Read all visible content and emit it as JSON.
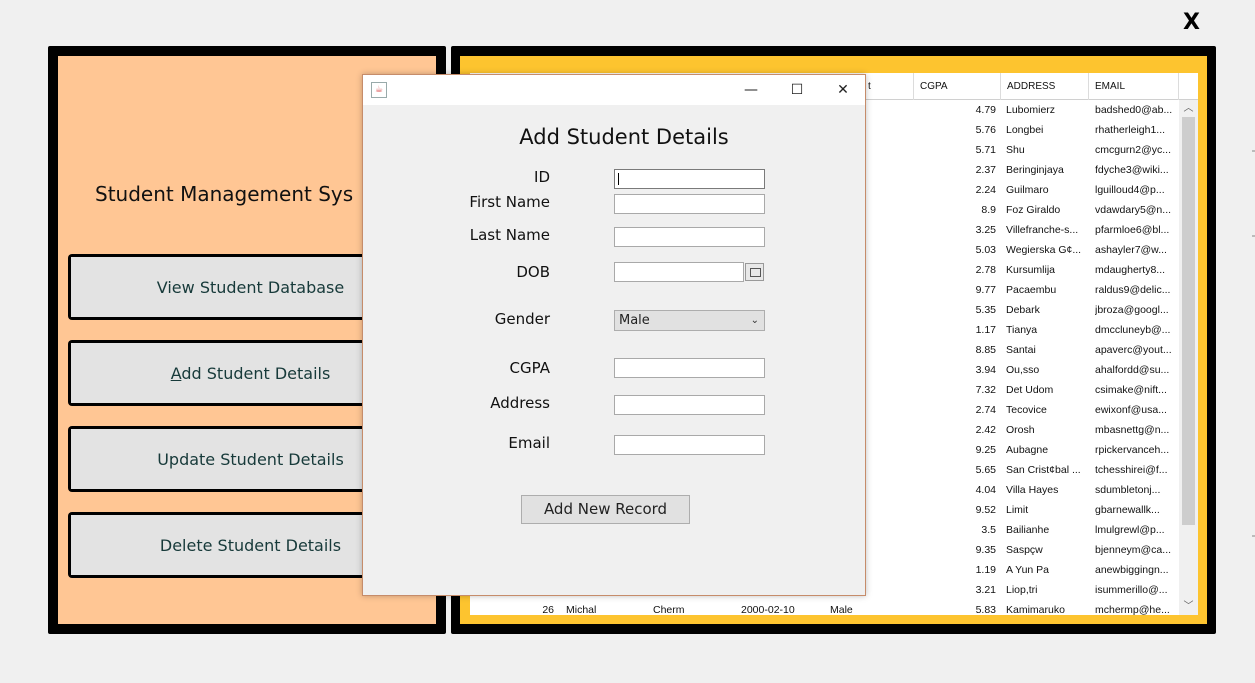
{
  "window": {
    "close_label": "X"
  },
  "sidebar": {
    "title": "Student Management Sys",
    "buttons": [
      {
        "label": "View Student Database"
      },
      {
        "label": "Add Student Details",
        "mnemonic": "A"
      },
      {
        "label": "Update Student Details"
      },
      {
        "label": "Delete Student Details"
      }
    ]
  },
  "table": {
    "headers": {
      "partial": "t",
      "cgpa": "CGPA",
      "address": "ADDRESS",
      "email": "EMAIL"
    },
    "rows": [
      {
        "cgpa": "4.79",
        "address": "Lubomierz",
        "email": "badshed0@ab..."
      },
      {
        "cgpa": "5.76",
        "address": "Longbei",
        "email": "rhatherleigh1..."
      },
      {
        "cgpa": "5.71",
        "address": "Shu",
        "email": "cmcgurn2@yc..."
      },
      {
        "cgpa": "2.37",
        "address": "Beringinjaya",
        "email": "fdyche3@wiki..."
      },
      {
        "cgpa": "2.24",
        "address": "Guilmaro",
        "email": "lguilloud4@p..."
      },
      {
        "cgpa": "8.9",
        "address": "Foz Giraldo",
        "email": "vdawdary5@n..."
      },
      {
        "cgpa": "3.25",
        "address": "Villefranche-s...",
        "email": "pfarmloe6@bl..."
      },
      {
        "cgpa": "5.03",
        "address": "Wegierska G¢...",
        "email": "ashayler7@w..."
      },
      {
        "cgpa": "2.78",
        "address": "Kursumlija",
        "email": "mdaugherty8..."
      },
      {
        "cgpa": "9.77",
        "address": "Pacaembu",
        "email": "raldus9@delic..."
      },
      {
        "cgpa": "5.35",
        "address": "Debark",
        "email": "jbroza@googl..."
      },
      {
        "cgpa": "1.17",
        "address": "Tianya",
        "email": "dmccluneyb@..."
      },
      {
        "cgpa": "8.85",
        "address": "Santai",
        "email": "apaverc@yout..."
      },
      {
        "cgpa": "3.94",
        "address": "Ou,sso",
        "email": "ahalfordd@su..."
      },
      {
        "cgpa": "7.32",
        "address": "Det Udom",
        "email": "csimake@nift..."
      },
      {
        "cgpa": "2.74",
        "address": "Tecovice",
        "email": "ewixonf@usa..."
      },
      {
        "cgpa": "2.42",
        "address": "Orosh",
        "email": "mbasnettg@n..."
      },
      {
        "cgpa": "9.25",
        "address": "Aubagne",
        "email": "rpickervanceh..."
      },
      {
        "cgpa": "5.65",
        "address": "San Crist¢bal ...",
        "email": "tchesshirei@f..."
      },
      {
        "cgpa": "4.04",
        "address": "Villa Hayes",
        "email": "sdumbletonj..."
      },
      {
        "cgpa": "9.52",
        "address": "Limit",
        "email": "gbarnewallk..."
      },
      {
        "cgpa": "3.5",
        "address": "Bailianhe",
        "email": "lmulgrewl@p..."
      },
      {
        "cgpa": "9.35",
        "address": "Saspçw",
        "email": "bjenneym@ca..."
      },
      {
        "cgpa": "1.19",
        "address": "A Yun Pa",
        "email": "anewbiggingn..."
      },
      {
        "cgpa": "3.21",
        "address": "Liop,tri",
        "email": "isummerillo@..."
      },
      {
        "id": "26",
        "first": "Michal",
        "last": "Cherm",
        "dob": "2000-02-10",
        "gender": "Male",
        "cgpa": "5.83",
        "address": "Kamimaruko",
        "email": "mchermp@he..."
      }
    ]
  },
  "dialog": {
    "window_controls": {
      "minimize": "—",
      "maximize": "☐",
      "close": "✕"
    },
    "title": "Add Student Details",
    "labels": {
      "id": "ID",
      "first": "First Name",
      "last": "Last Name",
      "dob": "DOB",
      "gender": "Gender",
      "cgpa": "CGPA",
      "address": "Address",
      "email": "Email"
    },
    "gender_selected": "Male",
    "submit_label": "Add New Record"
  }
}
